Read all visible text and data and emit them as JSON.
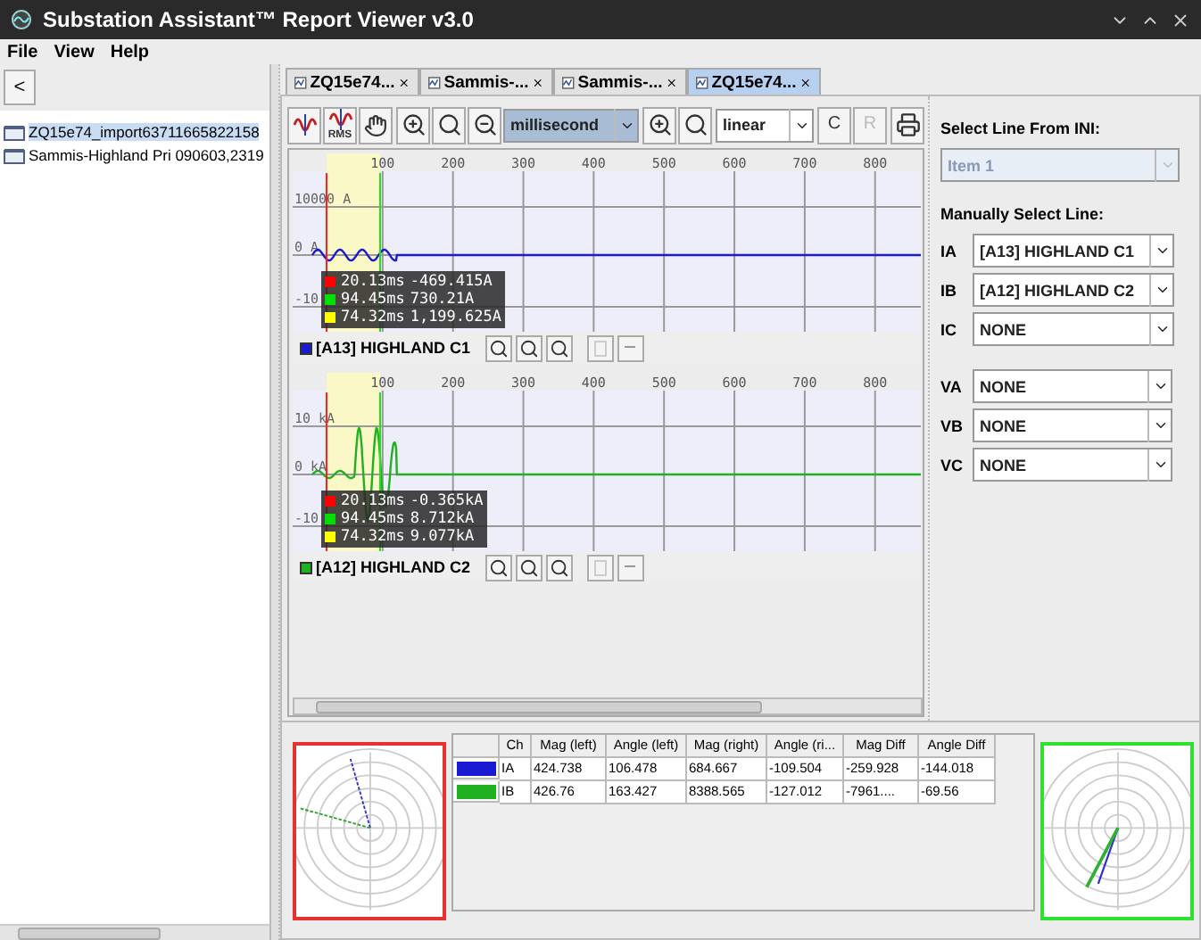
{
  "window": {
    "title": "Substation Assistant™ Report Viewer v3.0"
  },
  "menu": [
    "File",
    "View",
    "Help"
  ],
  "sidebar": {
    "collapse_button": "<",
    "items": [
      {
        "label": "ZQ15e74_import63711665822158",
        "selected": true
      },
      {
        "label": "Sammis-Highland Pri 090603,2319",
        "selected": false
      }
    ]
  },
  "tabs": [
    {
      "label": "ZQ15e74...",
      "selected": false
    },
    {
      "label": "Sammis-...",
      "selected": false
    },
    {
      "label": "Sammis-...",
      "selected": false
    },
    {
      "label": "ZQ15e74...",
      "selected": true
    }
  ],
  "toolbar": {
    "rms_label": "RMS",
    "time_unit": "millisecond",
    "scale": "linear",
    "copy_label": "C",
    "report_label": "R",
    "report_disabled": true
  },
  "charts": [
    {
      "label": "[A13] HIGHLAND C1",
      "color": "#1a1ad0",
      "x_ticks": [
        "100",
        "200",
        "300",
        "400",
        "500",
        "600",
        "700",
        "800"
      ],
      "y_labels": [
        "10000 A",
        "0 A",
        "-10"
      ],
      "readout": [
        {
          "time": "20.13ms",
          "value": "-469.415A",
          "color": "#ff0000"
        },
        {
          "time": "94.45ms",
          "value": "730.21A",
          "color": "#00e000"
        },
        {
          "time": "74.32ms",
          "value": "1,199.625A",
          "color": "#ffff00"
        }
      ]
    },
    {
      "label": "[A12] HIGHLAND C2",
      "color": "#20b020",
      "x_ticks": [
        "100",
        "200",
        "300",
        "400",
        "500",
        "600",
        "700",
        "800"
      ],
      "y_labels": [
        "10 kA",
        "0 kA",
        "-10"
      ],
      "readout": [
        {
          "time": "20.13ms",
          "value": "-0.365kA",
          "color": "#ff0000"
        },
        {
          "time": "94.45ms",
          "value": "8.712kA",
          "color": "#00e000"
        },
        {
          "time": "74.32ms",
          "value": "9.077kA",
          "color": "#ffff00"
        }
      ]
    }
  ],
  "line_select": {
    "ini_title": "Select Line From INI:",
    "ini": {
      "value": "Item 1",
      "disabled": true
    },
    "manual_title": "Manually Select Line:",
    "channels": [
      {
        "label": "IA",
        "value": "[A13] HIGHLAND C1"
      },
      {
        "label": "IB",
        "value": "[A12] HIGHLAND C2"
      },
      {
        "label": "IC",
        "value": "NONE"
      },
      {
        "label": "VA",
        "value": "NONE"
      },
      {
        "label": "VB",
        "value": "NONE"
      },
      {
        "label": "VC",
        "value": "NONE"
      }
    ]
  },
  "phasor_plots": [
    {
      "color": "#e83030"
    },
    {
      "color": "#30e030"
    }
  ],
  "phasor_table": {
    "columns": [
      "",
      "Ch",
      "Mag (left)",
      "Angle (left)",
      "Mag (right)",
      "Angle (ri...",
      "Mag Diff",
      "Angle Diff"
    ],
    "rows": [
      {
        "color": "#1a1ad0",
        "cells": [
          "",
          "IA",
          "424.738",
          "106.478",
          "684.667",
          "-109.504",
          "-259.928",
          "-144.018"
        ]
      },
      {
        "color": "#20b020",
        "cells": [
          "",
          "IB",
          "426.76",
          "163.427",
          "8388.565",
          "-127.012",
          "-7961....",
          "-69.56"
        ]
      }
    ]
  }
}
